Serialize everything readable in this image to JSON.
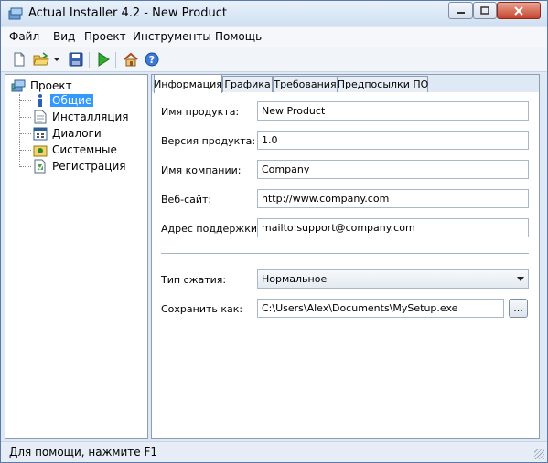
{
  "window": {
    "title": "Actual Installer 4.2 - New Product"
  },
  "menu": {
    "items": [
      "Файл",
      "Вид",
      "Проект",
      "Инструменты",
      "Помощь"
    ]
  },
  "toolbar": {
    "icons": [
      "new-file-icon",
      "open-folder-icon",
      "dropdown-arrow-icon",
      "save-icon",
      "build-run-icon",
      "home-icon",
      "help-icon"
    ]
  },
  "tree": {
    "root": "Проект",
    "items": [
      {
        "label": "Общие",
        "icon": "info-icon",
        "selected": true
      },
      {
        "label": "Инсталляция",
        "icon": "document-icon",
        "selected": false
      },
      {
        "label": "Диалоги",
        "icon": "dialog-icon",
        "selected": false
      },
      {
        "label": "Системные",
        "icon": "system-icon",
        "selected": false
      },
      {
        "label": "Регистрация",
        "icon": "registration-icon",
        "selected": false
      }
    ]
  },
  "tabs": [
    {
      "label": "Информация",
      "active": true
    },
    {
      "label": "Графика",
      "active": false
    },
    {
      "label": "Требования",
      "active": false
    },
    {
      "label": "Предпосылки ПО",
      "active": false
    }
  ],
  "form": {
    "product_name": {
      "label": "Имя продукта:",
      "value": "New Product"
    },
    "product_version": {
      "label": "Версия продукта:",
      "value": "1.0"
    },
    "company_name": {
      "label": "Имя компании:",
      "value": "Company"
    },
    "website": {
      "label": "Веб-сайт:",
      "value": "http://www.company.com"
    },
    "support_address": {
      "label": "Адрес поддержки:",
      "value": "mailto:support@company.com"
    },
    "compression": {
      "label": "Тип сжатия:",
      "value": "Нормальное"
    },
    "save_as": {
      "label": "Сохранить как:",
      "value": "C:\\Users\\Alex\\Documents\\MySetup.exe",
      "browse_label": "..."
    }
  },
  "status": {
    "text": "Для помощи, нажмите F1"
  }
}
